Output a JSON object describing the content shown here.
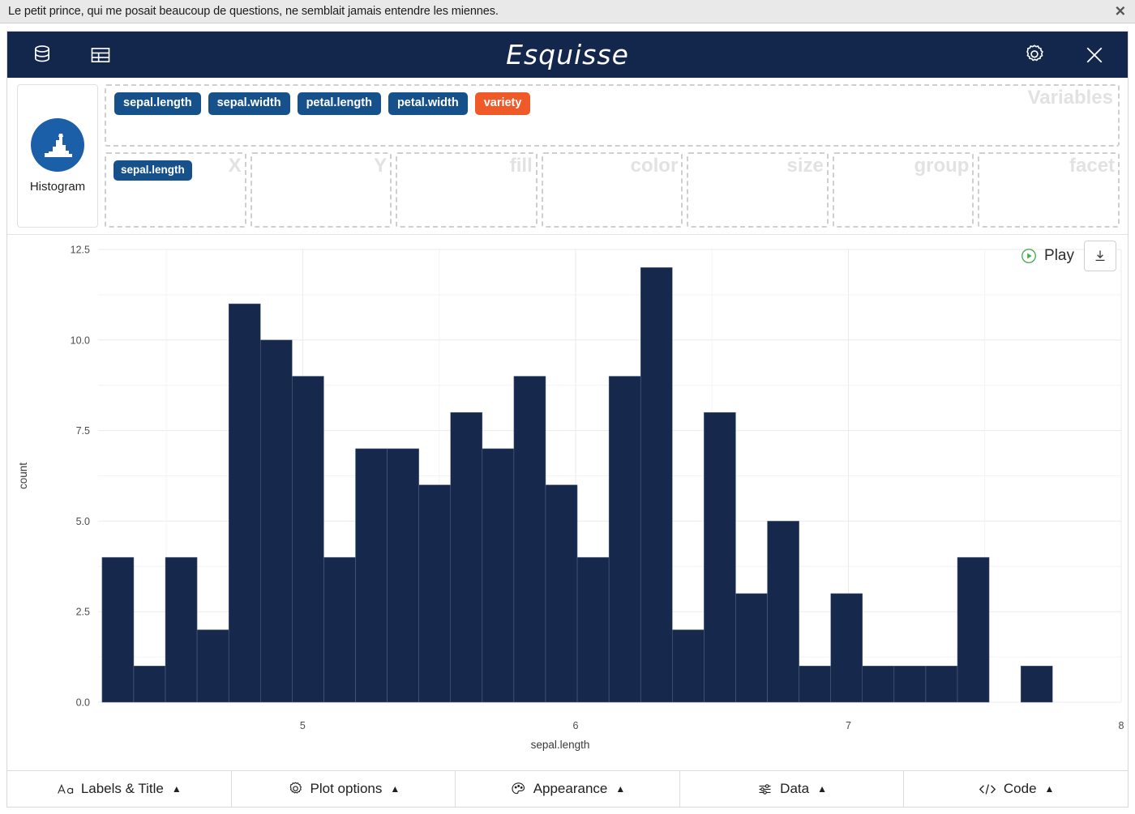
{
  "notification": {
    "message": "Le petit prince, qui me posait beaucoup de questions, ne semblait jamais entendre les miennes.",
    "close_icon": "close-icon"
  },
  "navbar": {
    "title": "Esquisse",
    "left_icons": [
      {
        "name": "database-icon"
      },
      {
        "name": "table-icon"
      }
    ],
    "right_icons": [
      {
        "name": "gear-icon"
      },
      {
        "name": "close-icon"
      }
    ]
  },
  "geom": {
    "label": "Histogram",
    "icon": "histogram-icon",
    "accent_color": "#1b5fa8"
  },
  "variables": {
    "zone_label": "Variables",
    "chips": [
      {
        "label": "sepal.length",
        "color": "#17518c",
        "type": "numeric"
      },
      {
        "label": "sepal.width",
        "color": "#17518c",
        "type": "numeric"
      },
      {
        "label": "petal.length",
        "color": "#17518c",
        "type": "numeric"
      },
      {
        "label": "petal.width",
        "color": "#17518c",
        "type": "numeric"
      },
      {
        "label": "variety",
        "color": "#f05a28",
        "type": "categorical"
      }
    ]
  },
  "aesthetics": [
    {
      "zone": "X",
      "chips": [
        {
          "label": "sepal.length",
          "color": "#17518c"
        }
      ]
    },
    {
      "zone": "Y",
      "chips": []
    },
    {
      "zone": "fill",
      "chips": []
    },
    {
      "zone": "color",
      "chips": []
    },
    {
      "zone": "size",
      "chips": []
    },
    {
      "zone": "group",
      "chips": []
    },
    {
      "zone": "facet",
      "chips": []
    }
  ],
  "plot_controls": {
    "play_label": "Play",
    "play_icon": "play-circle-icon",
    "download_icon": "download-icon"
  },
  "bottom_bar": {
    "buttons": [
      {
        "label": "Labels & Title",
        "icon": "text-aa-icon",
        "caret": "▲"
      },
      {
        "label": "Plot options",
        "icon": "gear-icon",
        "caret": "▲"
      },
      {
        "label": "Appearance",
        "icon": "palette-icon",
        "caret": "▲"
      },
      {
        "label": "Data",
        "icon": "sliders-icon",
        "caret": "▲"
      },
      {
        "label": "Code",
        "icon": "code-icon",
        "caret": "▲"
      }
    ]
  },
  "chart_data": {
    "type": "bar",
    "title": "",
    "xlabel": "sepal.length",
    "ylabel": "count",
    "bar_color": "#16284c",
    "xlim": [
      4.25,
      8.0
    ],
    "ylim": [
      0,
      12.5
    ],
    "xticks": [
      5,
      6,
      7,
      8
    ],
    "yticks": [
      0.0,
      2.5,
      5.0,
      7.5,
      10.0,
      12.5
    ],
    "ytick_labels": [
      "0.0",
      "2.5",
      "5.0",
      "7.5",
      "10.0",
      "12.5"
    ],
    "xtick_labels": [
      "5",
      "6",
      "7",
      "8"
    ],
    "grid": true,
    "bin_width": 0.1161,
    "bin_starts": [
      4.2645,
      4.3806,
      4.4967,
      4.6128,
      4.729,
      4.8451,
      4.9612,
      5.0773,
      5.1935,
      5.3096,
      5.4257,
      5.5418,
      5.658,
      5.7741,
      5.8902,
      6.0063,
      6.1224,
      6.2386,
      6.3547,
      6.4708,
      6.5869,
      6.7031,
      6.8192,
      6.9353,
      7.0514,
      7.1675,
      7.2837,
      7.3998,
      7.5159,
      7.632,
      7.7482,
      7.8643
    ],
    "values": [
      4,
      1,
      4,
      2,
      11,
      10,
      9,
      4,
      7,
      7,
      6,
      8,
      7,
      9,
      6,
      4,
      9,
      12,
      2,
      8,
      3,
      5,
      1,
      3,
      1,
      1,
      1,
      4,
      0,
      1
    ],
    "n_bins": 30,
    "legend": null
  }
}
